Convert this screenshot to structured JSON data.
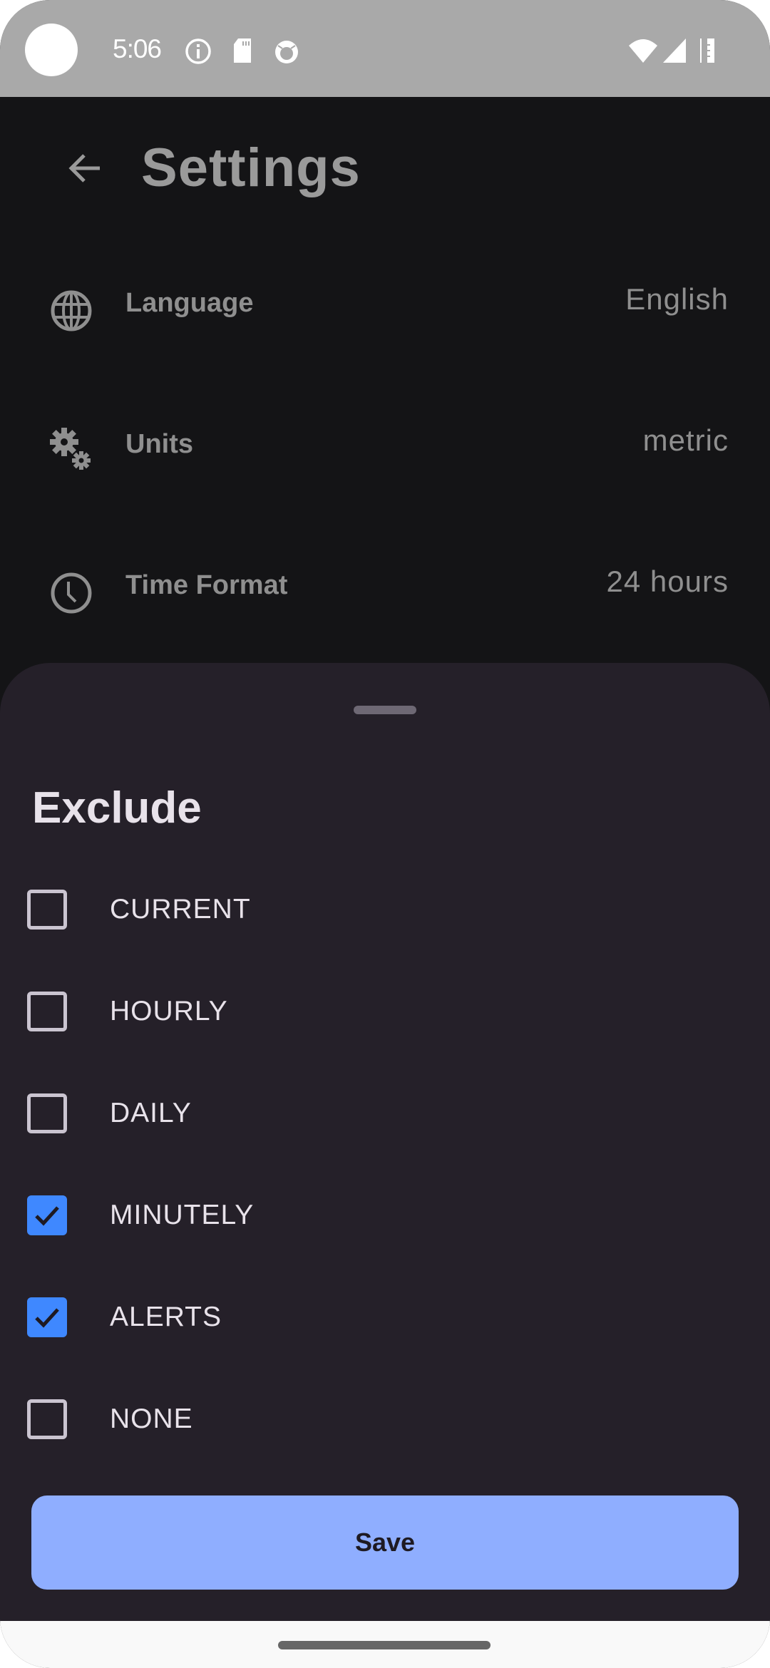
{
  "status_bar": {
    "time": "5:06",
    "left_icons": [
      "info-icon",
      "sd-card-icon",
      "android-debug-icon"
    ],
    "right_icons": [
      "wifi-icon",
      "cell-signal-icon",
      "battery-icon"
    ]
  },
  "app_bar": {
    "back_icon": "arrow-left-icon",
    "title": "Settings"
  },
  "settings": [
    {
      "icon": "globe-icon",
      "label": "Language",
      "value": "English"
    },
    {
      "icon": "gears-icon",
      "label": "Units",
      "value": "metric"
    },
    {
      "icon": "clock-icon",
      "label": "Time Format",
      "value": "24 hours"
    }
  ],
  "sheet": {
    "title": "Exclude",
    "options": [
      {
        "label": "CURRENT",
        "checked": false
      },
      {
        "label": "HOURLY",
        "checked": false
      },
      {
        "label": "DAILY",
        "checked": false
      },
      {
        "label": "MINUTELY",
        "checked": true
      },
      {
        "label": "ALERTS",
        "checked": true
      },
      {
        "label": "NONE",
        "checked": false
      }
    ],
    "save_label": "Save"
  },
  "colors": {
    "accent": "#3f88ff",
    "button": "#8faeff",
    "sheet_bg": "#252029",
    "screen_bg": "#141416"
  }
}
